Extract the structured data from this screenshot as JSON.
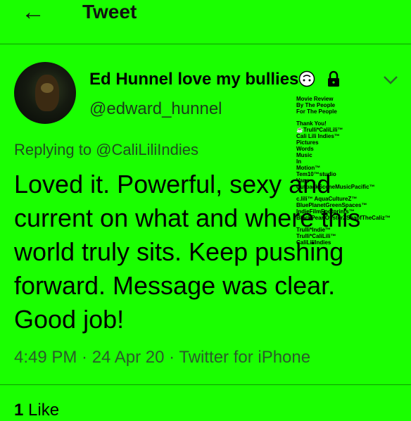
{
  "header": {
    "back_icon": "arrow-left-icon",
    "title": "Tweet"
  },
  "tweet": {
    "author_name": "Ed Hunnel love my bullies",
    "name_emoji": "upside-down-face-icon",
    "lock_icon": "lock-icon",
    "handle": "@edward_hunnel",
    "replying_to": "Replying to @CaliLiliIndies",
    "text": "Loved it. Powerful, sexy and current on what and where this world truly sits. Keep pushing forward. Message was clear. Good job!",
    "timestamp": "4:49 PM · 24 Apr 20 · Twitter for iPhone",
    "likes_count": "1",
    "likes_label": "Like"
  },
  "poster": {
    "lines_a": [
      "Movie Review",
      "By The People",
      "For The People"
    ],
    "lines_b": [
      "Thank You!",
      "☕Trulli*CaliLili™",
      "Cali Lili Indies™",
      "Pictures",
      "Words",
      "Music",
      "In",
      "Motion™",
      "Tem10™studio",
      "Vans",
      "CutbackSceneMusicPacific™"
    ],
    "lines_c": [
      "c.lili™ AquaCultureZ™",
      "BluePlanetGreenSpaces™",
      "IndieFilmFootprints™",
      "BlackPearlOysterZSeaofTheCaliz™"
    ],
    "lines_d": [
      "Trulli*Indie™",
      "Trulli*CaliLili™",
      "CaliLiliIndies"
    ]
  },
  "colors": {
    "background": "#1aff00"
  }
}
